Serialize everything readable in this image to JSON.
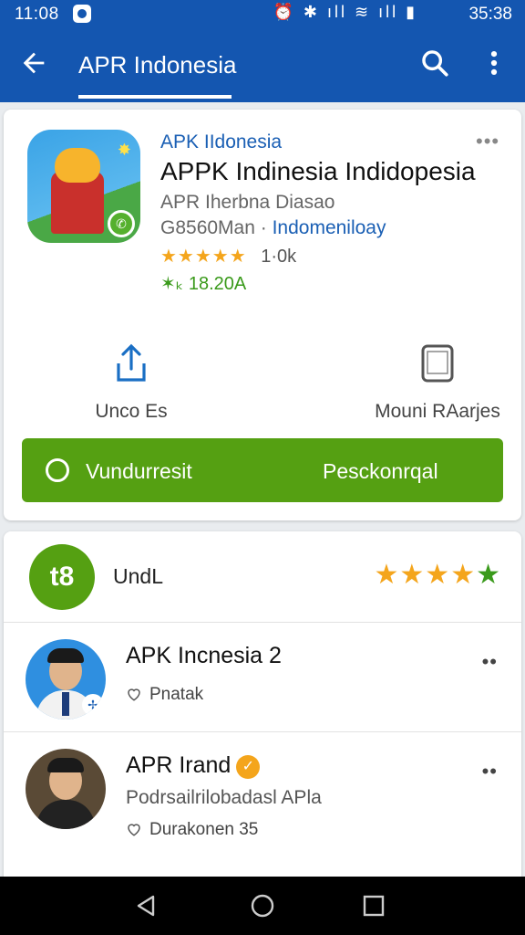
{
  "status_bar": {
    "time_left": "11:08",
    "signal_icons": "⏰ ✱ ıll ≋ ıll ▮",
    "time_right": "35:38"
  },
  "app_bar": {
    "title": "APR Indonesia"
  },
  "app": {
    "developer": "APK IIdonesia",
    "menu": "•••",
    "title": "APPK Indinesia Indidopesia",
    "subtitle": "APR Iherbna Diasao",
    "meta_prefix": "G8560Man",
    "meta_sep": " · ",
    "meta_link": "Indomeniloay",
    "stars": "★★★★★",
    "rating_text": "1·0k",
    "downloads": "18.20A",
    "download_icon": "✶ₖ ",
    "actions": [
      {
        "label": "Unco Es",
        "icon": "share-icon"
      },
      {
        "label": "Mouni RAarjes",
        "icon": "phone-icon"
      }
    ],
    "install_left": "Vundurresit",
    "install_right": "Pesckonrqal",
    "accent": "#55a012",
    "brand": "#1456b0"
  },
  "reviews": {
    "score": "t8",
    "label": "UndL",
    "stars": "★★★★",
    "last_star": "★",
    "items": [
      {
        "name": "APK Incnesia 2",
        "likes": "Pnatak",
        "menu": "••"
      },
      {
        "name": "APR Irand",
        "verified_mark": "✓",
        "description": "Podrsailrilobadasl APla",
        "likes": "Durakonen  35",
        "menu": "••"
      }
    ]
  }
}
